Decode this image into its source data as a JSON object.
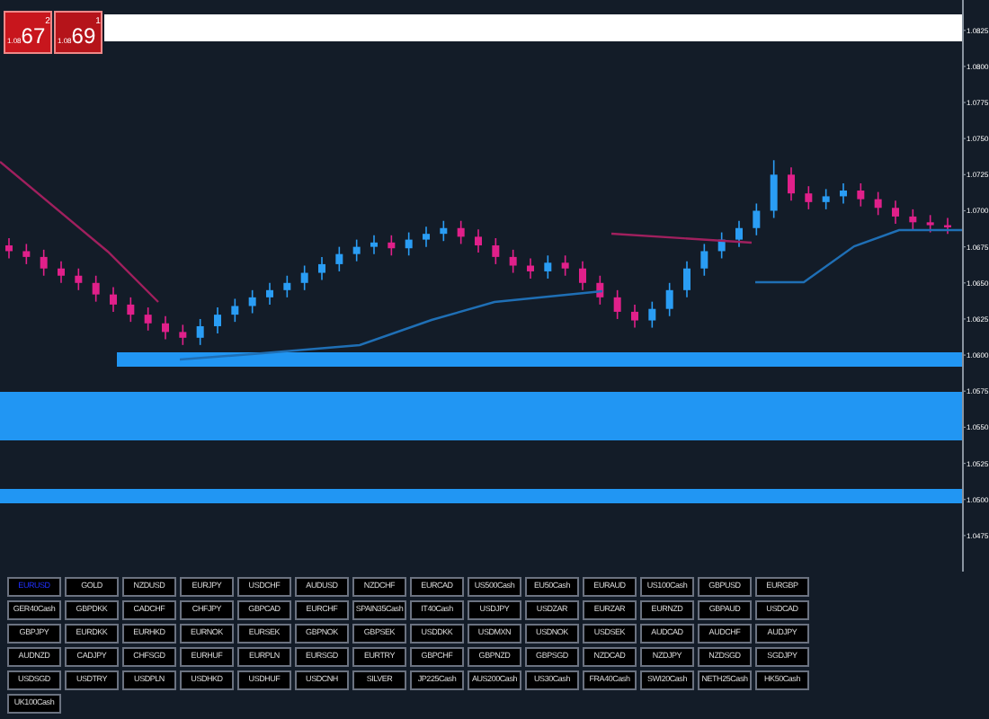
{
  "trade_buttons": [
    {
      "kind": "sell",
      "prefix": "1.08",
      "big": "67",
      "pip": "2"
    },
    {
      "kind": "buy",
      "prefix": "1.08",
      "big": "69",
      "pip": "1"
    }
  ],
  "chart": {
    "chart_data": {
      "type": "candlestick",
      "ylim": [
        1.045,
        1.0846
      ],
      "yticks": [
        {
          "value": 1.0825,
          "label": "1.0825"
        },
        {
          "value": 1.08,
          "label": "1.0800"
        },
        {
          "value": 1.0775,
          "label": "1.0775"
        },
        {
          "value": 1.075,
          "label": "1.0750"
        },
        {
          "value": 1.0725,
          "label": "1.0725"
        },
        {
          "value": 1.07,
          "label": "1.0700"
        },
        {
          "value": 1.0675,
          "label": "1.0675"
        },
        {
          "value": 1.065,
          "label": "1.0650"
        },
        {
          "value": 1.0625,
          "label": "1.0625"
        },
        {
          "value": 1.06,
          "label": "1.0600"
        },
        {
          "value": 1.0575,
          "label": "1.0575"
        },
        {
          "value": 1.055,
          "label": "1.0550"
        },
        {
          "value": 1.0525,
          "label": "1.0525"
        },
        {
          "value": 1.05,
          "label": "1.0500"
        },
        {
          "value": 1.0475,
          "label": "1.0475"
        }
      ],
      "ohlc": [
        [
          1.0676,
          1.0681,
          1.0667,
          1.0672
        ],
        [
          1.0672,
          1.0677,
          1.0663,
          1.0668
        ],
        [
          1.0668,
          1.0673,
          1.0655,
          1.066
        ],
        [
          1.066,
          1.0665,
          1.065,
          1.0655
        ],
        [
          1.0655,
          1.066,
          1.0645,
          1.065
        ],
        [
          1.065,
          1.0655,
          1.0637,
          1.0642
        ],
        [
          1.0642,
          1.0647,
          1.063,
          1.0635
        ],
        [
          1.0635,
          1.064,
          1.0623,
          1.0628
        ],
        [
          1.0628,
          1.0633,
          1.0617,
          1.0622
        ],
        [
          1.0622,
          1.0627,
          1.0611,
          1.0616
        ],
        [
          1.0616,
          1.0621,
          1.0607,
          1.0612
        ],
        [
          1.0612,
          1.0625,
          1.0607,
          1.062
        ],
        [
          1.062,
          1.0633,
          1.0615,
          1.0628
        ],
        [
          1.0628,
          1.0639,
          1.0623,
          1.0634
        ],
        [
          1.0634,
          1.0645,
          1.0629,
          1.064
        ],
        [
          1.064,
          1.065,
          1.0635,
          1.0645
        ],
        [
          1.0645,
          1.0655,
          1.064,
          1.065
        ],
        [
          1.065,
          1.0662,
          1.0645,
          1.0657
        ],
        [
          1.0657,
          1.0668,
          1.0652,
          1.0663
        ],
        [
          1.0663,
          1.0675,
          1.0658,
          1.067
        ],
        [
          1.067,
          1.068,
          1.0665,
          1.0675
        ],
        [
          1.0675,
          1.0683,
          1.067,
          1.0678
        ],
        [
          1.0678,
          1.0683,
          1.0669,
          1.0674
        ],
        [
          1.0674,
          1.0685,
          1.0669,
          1.068
        ],
        [
          1.068,
          1.0689,
          1.0675,
          1.0684
        ],
        [
          1.0684,
          1.0693,
          1.0679,
          1.0688
        ],
        [
          1.0688,
          1.0693,
          1.0677,
          1.0682
        ],
        [
          1.0682,
          1.0687,
          1.0671,
          1.0676
        ],
        [
          1.0676,
          1.0681,
          1.0663,
          1.0668
        ],
        [
          1.0668,
          1.0673,
          1.0657,
          1.0662
        ],
        [
          1.0662,
          1.0667,
          1.0653,
          1.0658
        ],
        [
          1.0658,
          1.0669,
          1.0653,
          1.0664
        ],
        [
          1.0664,
          1.0669,
          1.0655,
          1.066
        ],
        [
          1.066,
          1.0665,
          1.0645,
          1.065
        ],
        [
          1.065,
          1.0655,
          1.0635,
          1.064
        ],
        [
          1.064,
          1.0645,
          1.0625,
          1.063
        ],
        [
          1.063,
          1.0635,
          1.0619,
          1.0624
        ],
        [
          1.0624,
          1.0637,
          1.0619,
          1.0632
        ],
        [
          1.0632,
          1.065,
          1.0627,
          1.0645
        ],
        [
          1.0645,
          1.0665,
          1.064,
          1.066
        ],
        [
          1.066,
          1.0677,
          1.0655,
          1.0672
        ],
        [
          1.0672,
          1.0685,
          1.0667,
          1.068
        ],
        [
          1.068,
          1.0693,
          1.0675,
          1.0688
        ],
        [
          1.0688,
          1.0705,
          1.0683,
          1.07
        ],
        [
          1.07,
          1.0735,
          1.0695,
          1.0725
        ],
        [
          1.0725,
          1.073,
          1.0707,
          1.0712
        ],
        [
          1.0712,
          1.0717,
          1.0701,
          1.0706
        ],
        [
          1.0706,
          1.0715,
          1.0701,
          1.071
        ],
        [
          1.071,
          1.0719,
          1.0705,
          1.0714
        ],
        [
          1.0714,
          1.0719,
          1.0703,
          1.0708
        ],
        [
          1.0708,
          1.0713,
          1.0697,
          1.0702
        ],
        [
          1.0702,
          1.0707,
          1.0691,
          1.0696
        ],
        [
          1.0696,
          1.0701,
          1.0687,
          1.0692
        ],
        [
          1.0692,
          1.0697,
          1.0685,
          1.069
        ],
        [
          1.069,
          1.0695,
          1.0684,
          1.0689
        ]
      ]
    }
  },
  "symbols": [
    {
      "label": "EURUSD",
      "selected": true
    },
    {
      "label": "GOLD",
      "selected": false
    },
    {
      "label": "NZDUSD",
      "selected": false
    },
    {
      "label": "EURJPY",
      "selected": false
    },
    {
      "label": "USDCHF",
      "selected": false
    },
    {
      "label": "AUDUSD",
      "selected": false
    },
    {
      "label": "NZDCHF",
      "selected": false
    },
    {
      "label": "EURCAD",
      "selected": false
    },
    {
      "label": "US500Cash",
      "selected": false
    },
    {
      "label": "EU50Cash",
      "selected": false
    },
    {
      "label": "EURAUD",
      "selected": false
    },
    {
      "label": "US100Cash",
      "selected": false
    },
    {
      "label": "GBPUSD",
      "selected": false
    },
    {
      "label": "EURGBP",
      "selected": false
    },
    {
      "label": "GER40Cash",
      "selected": false
    },
    {
      "label": "GBPDKK",
      "selected": false
    },
    {
      "label": "CADCHF",
      "selected": false
    },
    {
      "label": "CHFJPY",
      "selected": false
    },
    {
      "label": "GBPCAD",
      "selected": false
    },
    {
      "label": "EURCHF",
      "selected": false
    },
    {
      "label": "SPAIN35Cash",
      "selected": false
    },
    {
      "label": "IT40Cash",
      "selected": false
    },
    {
      "label": "USDJPY",
      "selected": false
    },
    {
      "label": "USDZAR",
      "selected": false
    },
    {
      "label": "EURZAR",
      "selected": false
    },
    {
      "label": "EURNZD",
      "selected": false
    },
    {
      "label": "GBPAUD",
      "selected": false
    },
    {
      "label": "USDCAD",
      "selected": false
    },
    {
      "label": "GBPJPY",
      "selected": false
    },
    {
      "label": "EURDKK",
      "selected": false
    },
    {
      "label": "EURHKD",
      "selected": false
    },
    {
      "label": "EURNOK",
      "selected": false
    },
    {
      "label": "EURSEK",
      "selected": false
    },
    {
      "label": "GBPNOK",
      "selected": false
    },
    {
      "label": "GBPSEK",
      "selected": false
    },
    {
      "label": "USDDKK",
      "selected": false
    },
    {
      "label": "USDMXN",
      "selected": false
    },
    {
      "label": "USDNOK",
      "selected": false
    },
    {
      "label": "USDSEK",
      "selected": false
    },
    {
      "label": "AUDCAD",
      "selected": false
    },
    {
      "label": "AUDCHF",
      "selected": false
    },
    {
      "label": "AUDJPY",
      "selected": false
    },
    {
      "label": "AUDNZD",
      "selected": false
    },
    {
      "label": "CADJPY",
      "selected": false
    },
    {
      "label": "CHFSGD",
      "selected": false
    },
    {
      "label": "EURHUF",
      "selected": false
    },
    {
      "label": "EURPLN",
      "selected": false
    },
    {
      "label": "EURSGD",
      "selected": false
    },
    {
      "label": "EURTRY",
      "selected": false
    },
    {
      "label": "GBPCHF",
      "selected": false
    },
    {
      "label": "GBPNZD",
      "selected": false
    },
    {
      "label": "GBPSGD",
      "selected": false
    },
    {
      "label": "NZDCAD",
      "selected": false
    },
    {
      "label": "NZDJPY",
      "selected": false
    },
    {
      "label": "NZDSGD",
      "selected": false
    },
    {
      "label": "SGDJPY",
      "selected": false
    },
    {
      "label": "USDSGD",
      "selected": false
    },
    {
      "label": "USDTRY",
      "selected": false
    },
    {
      "label": "USDPLN",
      "selected": false
    },
    {
      "label": "USDHKD",
      "selected": false
    },
    {
      "label": "USDHUF",
      "selected": false
    },
    {
      "label": "USDCNH",
      "selected": false
    },
    {
      "label": "SILVER",
      "selected": false
    },
    {
      "label": "JP225Cash",
      "selected": false
    },
    {
      "label": "AUS200Cash",
      "selected": false
    },
    {
      "label": "US30Cash",
      "selected": false
    },
    {
      "label": "FRA40Cash",
      "selected": false
    },
    {
      "label": "SWI20Cash",
      "selected": false
    },
    {
      "label": "NETH25Cash",
      "selected": false
    },
    {
      "label": "HK50Cash",
      "selected": false
    },
    {
      "label": "UK100Cash",
      "selected": false
    }
  ]
}
